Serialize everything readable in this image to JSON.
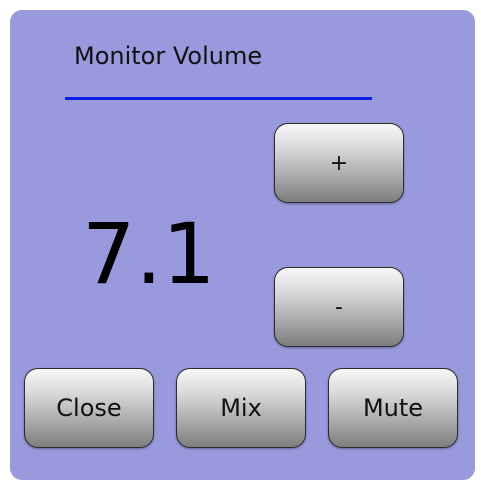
{
  "dialog": {
    "title": "Monitor Volume",
    "volume_value": "7.1",
    "increase_label": "+",
    "decrease_label": "-",
    "buttons": {
      "close_label": "Close",
      "mix_label": "Mix",
      "mute_label": "Mute"
    }
  },
  "colors": {
    "panel_background": "#9999dd",
    "title_underline": "#0a1ee0",
    "button_top": "#f7f7f7",
    "button_bottom": "#7d7d7d"
  }
}
